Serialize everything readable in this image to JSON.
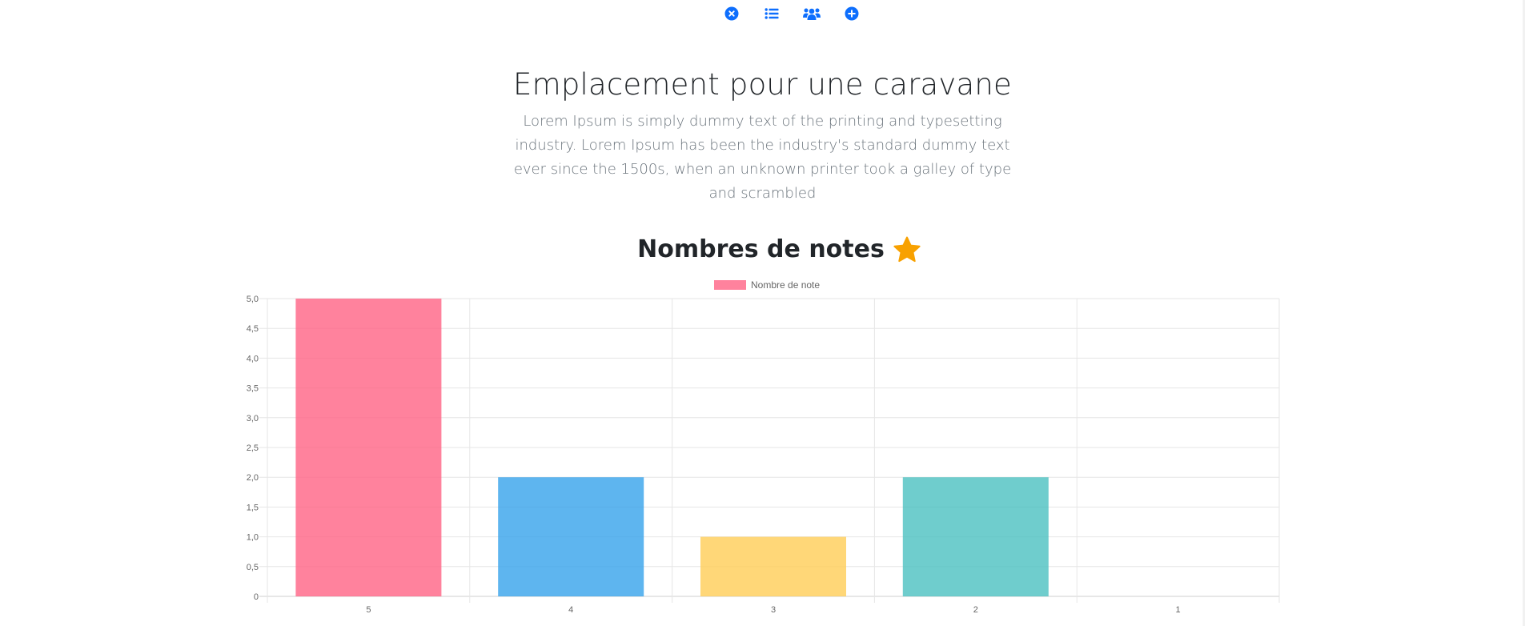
{
  "toolbar": {
    "icons": [
      "close-circle-icon",
      "list-icon",
      "users-icon",
      "plus-circle-icon"
    ],
    "accent": "#0d6efd"
  },
  "hero": {
    "title": "Emplacement pour une caravane",
    "description": "Lorem Ipsum is simply dummy text of the printing and typesetting industry. Lorem Ipsum has been the industry's standard dummy text ever since the 1500s, when an unknown printer took a galley of type and scrambled"
  },
  "rating_chart": {
    "heading": "Nombres de notes",
    "heading_icon": "star-icon",
    "star_color": "#f8a100"
  },
  "chart_data": {
    "type": "bar",
    "categories": [
      "5",
      "4",
      "3",
      "2",
      "1"
    ],
    "series": [
      {
        "name": "Nombre de note",
        "values": [
          5,
          2,
          1,
          2,
          0
        ]
      }
    ],
    "bar_colors": [
      "#ff6384",
      "#36a2eb",
      "#ffcd56",
      "#4bc0c0",
      "#9966ff"
    ],
    "ylim": [
      0,
      5
    ],
    "yticks": [
      "0",
      "0,5",
      "1,0",
      "1,5",
      "2,0",
      "2,5",
      "3,0",
      "3,5",
      "4,0",
      "4,5",
      "5,0"
    ],
    "grid": true,
    "legend_position": "top"
  }
}
